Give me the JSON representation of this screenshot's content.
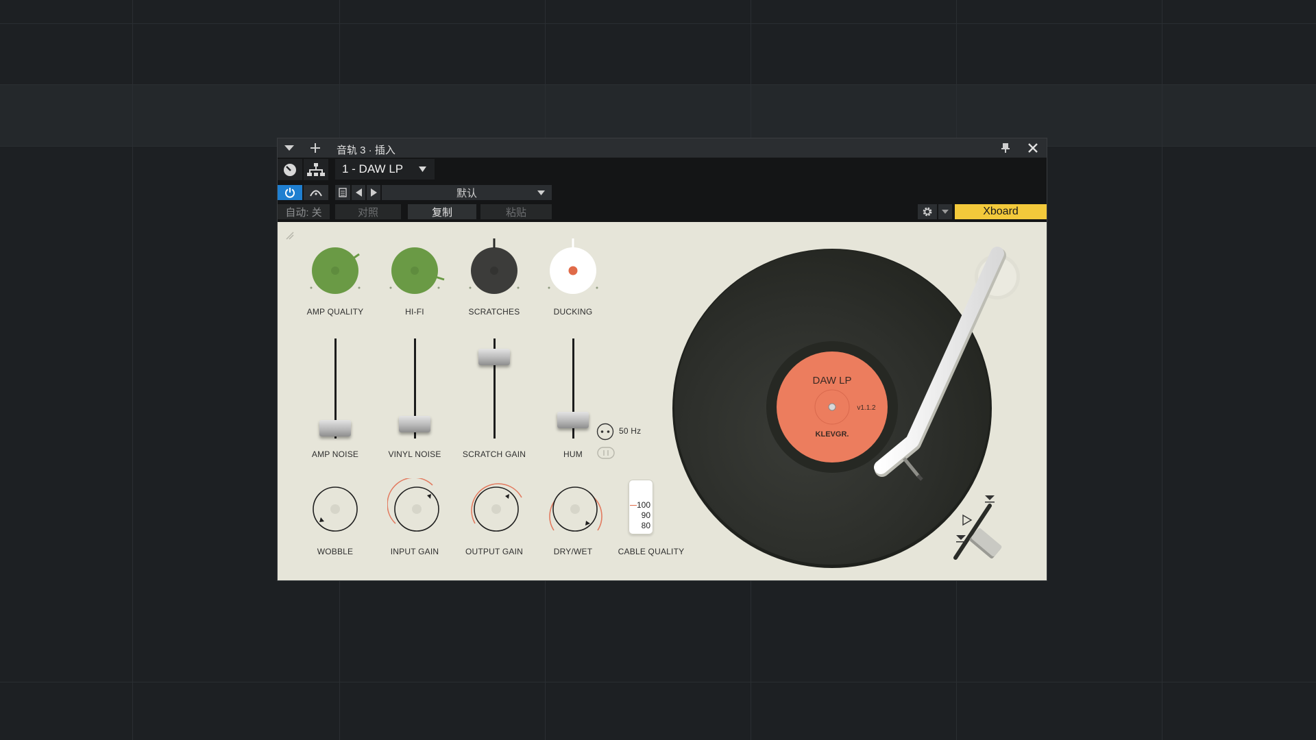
{
  "window": {
    "title": "音轨 3 · 插入",
    "preset_name": "1 - DAW LP",
    "preset_slot": "默认",
    "auto_label": "自动: 关",
    "compare_label": "对照",
    "copy_label": "复制",
    "paste_label": "粘贴",
    "xboard_label": "Xboard"
  },
  "plugin": {
    "knobs_top": [
      {
        "label": "AMP QUALITY",
        "color": "#6a9a45"
      },
      {
        "label": "HI-FI",
        "color": "#6a9a45"
      },
      {
        "label": "SCRATCHES",
        "color": "#3a3a3a"
      },
      {
        "label": "DUCKING",
        "color": "#ffffff"
      }
    ],
    "faders": [
      {
        "label": "AMP NOISE"
      },
      {
        "label": "VINYL NOISE"
      },
      {
        "label": "SCRATCH GAIN"
      },
      {
        "label": "HUM"
      }
    ],
    "hum_freq": "50 Hz",
    "knobs_bottom": [
      {
        "label": "WOBBLE"
      },
      {
        "label": "INPUT GAIN"
      },
      {
        "label": "OUTPUT GAIN"
      },
      {
        "label": "DRY/WET"
      }
    ],
    "cable_quality": {
      "label": "CABLE QUALITY",
      "ticks": [
        "100",
        "90",
        "80"
      ]
    },
    "record": {
      "title": "DAW LP",
      "version": "v1.1.2",
      "brand": "KLEVGR.",
      "label_color": "#ec7d5e",
      "vinyl_color": "#2c2e2a"
    }
  }
}
